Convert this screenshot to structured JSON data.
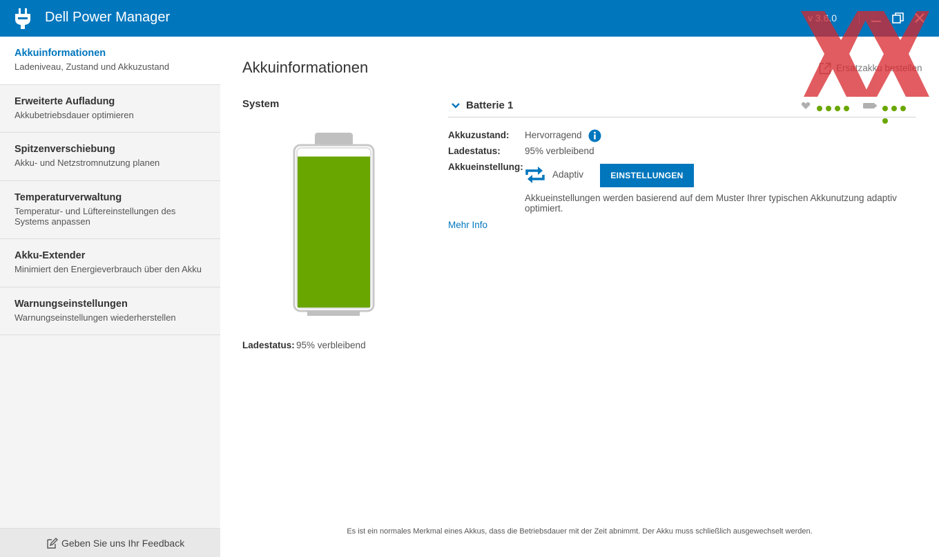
{
  "window": {
    "title": "Dell Power Manager",
    "version": "v 3.6.0",
    "colors": {
      "titlebar": "#0076bd",
      "accent": "#0076bd",
      "battery_green": "#6aa600"
    }
  },
  "sidebar": {
    "items": [
      {
        "title": "Akkuinformationen",
        "subtitle": "Ladeniveau, Zustand und Akkuzustand",
        "active": true
      },
      {
        "title": "Erweiterte Aufladung",
        "subtitle": "Akkubetriebsdauer optimieren"
      },
      {
        "title": "Spitzenverschiebung",
        "subtitle": "Akku- und Netzstromnutzung planen"
      },
      {
        "title": "Temperaturverwaltung",
        "subtitle": "Temperatur- und Lüftereinstellungen des Systems anpassen"
      },
      {
        "title": "Akku-Extender",
        "subtitle": "Minimiert den Energieverbrauch über den Akku"
      },
      {
        "title": "Warnungseinstellungen",
        "subtitle": "Warnungseinstellungen wiederherstellen"
      }
    ],
    "feedback_label": "Geben Sie uns Ihr Feedback"
  },
  "main": {
    "title": "Akkuinformationen",
    "order_link": "Ersatzakku bestellen",
    "system": {
      "heading": "System",
      "charge_percent": 95,
      "status_label": "Ladestatus:",
      "status_value": "95% verbleibend"
    },
    "battery1": {
      "title": "Batterie 1",
      "health_dots": 4,
      "charge_dots": 4,
      "health_label": "Akkuzustand:",
      "health_value": "Hervorragend",
      "status_label": "Ladestatus:",
      "status_value": "95% verbleibend",
      "setting_label": "Akkueinstellung:",
      "setting_value": "Adaptiv",
      "settings_button": "EINSTELLUNGEN",
      "setting_description": "Akkueinstellungen werden basierend auf dem Muster Ihrer typischen Akkunutzung adaptiv optimiert.",
      "more_info": "Mehr Info"
    },
    "footer_note": "Es ist ein normales Merkmal eines Akkus, dass die Betriebsdauer mit der Zeit abnimmt. Der Akku muss schließlich ausgewechselt werden."
  }
}
